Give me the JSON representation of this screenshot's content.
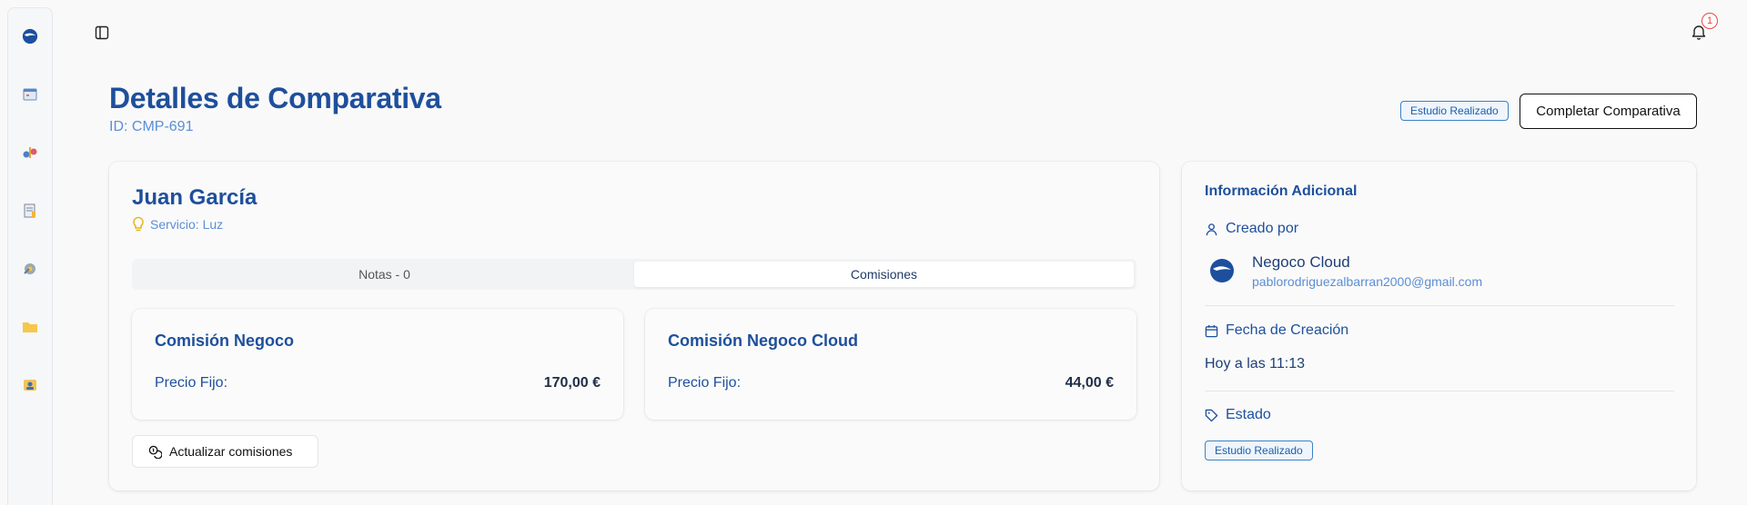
{
  "header": {
    "title": "Detalles de Comparativa",
    "id_label": "ID: CMP-691",
    "status": "Estudio Realizado",
    "complete_button": "Completar Comparativa"
  },
  "notifications": {
    "count": "1"
  },
  "client": {
    "name": "Juan García",
    "service": "Servicio: Luz"
  },
  "tabs": [
    {
      "label": "Notas - 0",
      "active": false
    },
    {
      "label": "Comisiones",
      "active": true
    }
  ],
  "commissions": [
    {
      "title": "Comisión Negoco",
      "label": "Precio Fijo:",
      "value": "170,00 €"
    },
    {
      "title": "Comisión Negoco Cloud",
      "label": "Precio Fijo:",
      "value": "44,00 €"
    }
  ],
  "update_button": "Actualizar comisiones",
  "info": {
    "title": "Información Adicional",
    "created_by_label": "Creado por",
    "creator_name": "Negoco Cloud",
    "creator_email": "pablorodriguezalbarran2000@gmail.com",
    "date_label": "Fecha de Creación",
    "date_value": "Hoy a las 11:13",
    "status_label": "Estado",
    "status_value": "Estudio Realizado"
  },
  "sidebar": {
    "icons": [
      "logo-icon",
      "calendar-icon",
      "comparison-icon",
      "documents-icon",
      "tools-icon",
      "folder-icon",
      "contacts-icon"
    ]
  },
  "colors": {
    "primary": "#1e4f9c",
    "accent_light": "#5b8ed6",
    "badge_red": "#ef4444"
  }
}
